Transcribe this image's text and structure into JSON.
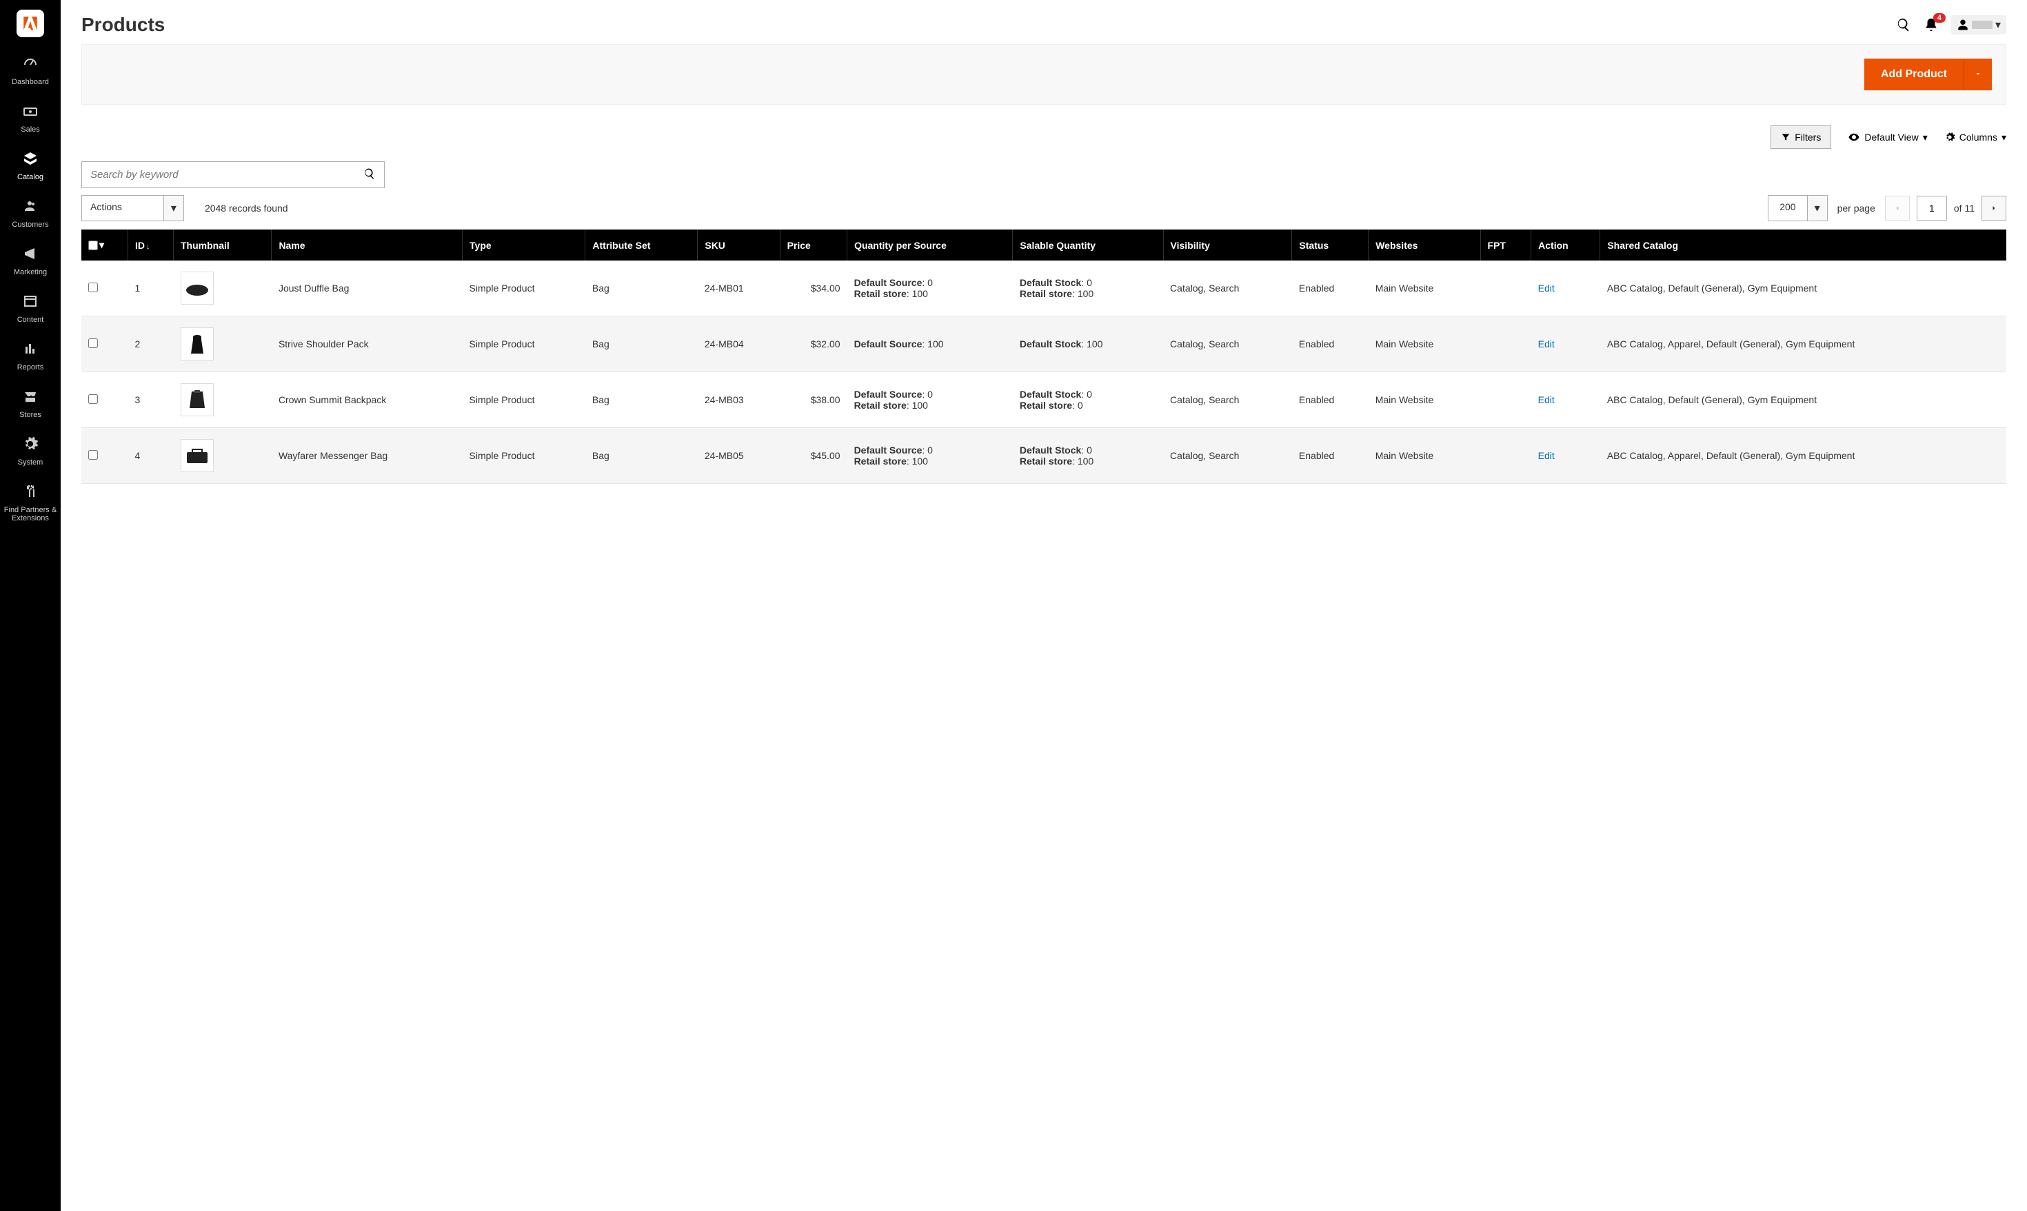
{
  "page": {
    "title": "Products",
    "notification_count": "4"
  },
  "sidebar": {
    "items": [
      {
        "label": "Dashboard"
      },
      {
        "label": "Sales"
      },
      {
        "label": "Catalog"
      },
      {
        "label": "Customers"
      },
      {
        "label": "Marketing"
      },
      {
        "label": "Content"
      },
      {
        "label": "Reports"
      },
      {
        "label": "Stores"
      },
      {
        "label": "System"
      },
      {
        "label": "Find Partners & Extensions"
      }
    ]
  },
  "action_bar": {
    "add_product": "Add Product"
  },
  "toolbar": {
    "filters": "Filters",
    "default_view": "Default View",
    "columns": "Columns"
  },
  "search": {
    "placeholder": "Search by keyword"
  },
  "controls": {
    "actions_label": "Actions",
    "records_found": "2048 records found",
    "per_page_value": "200",
    "per_page_label": "per page",
    "current_page": "1",
    "of_pages": "of 11"
  },
  "columns": {
    "id": "ID",
    "thumbnail": "Thumbnail",
    "name": "Name",
    "type": "Type",
    "attribute_set": "Attribute Set",
    "sku": "SKU",
    "price": "Price",
    "qty_per_source": "Quantity per Source",
    "salable_qty": "Salable Quantity",
    "visibility": "Visibility",
    "status": "Status",
    "websites": "Websites",
    "fpt": "FPT",
    "action": "Action",
    "shared_catalog": "Shared Catalog"
  },
  "rows": [
    {
      "id": "1",
      "name": "Joust Duffle Bag",
      "type": "Simple Product",
      "attr_set": "Bag",
      "sku": "24-MB01",
      "price": "$34.00",
      "qty_source": [
        {
          "label": "Default Source",
          "val": "0"
        },
        {
          "label": "Retail store",
          "val": "100"
        }
      ],
      "salable": [
        {
          "label": "Default Stock",
          "val": "0"
        },
        {
          "label": "Retail store",
          "val": "100"
        }
      ],
      "visibility": "Catalog, Search",
      "status": "Enabled",
      "websites": "Main Website",
      "action": "Edit",
      "shared": "ABC Catalog, Default (General), Gym Equipment"
    },
    {
      "id": "2",
      "name": "Strive Shoulder Pack",
      "type": "Simple Product",
      "attr_set": "Bag",
      "sku": "24-MB04",
      "price": "$32.00",
      "qty_source": [
        {
          "label": "Default Source",
          "val": "100"
        }
      ],
      "salable": [
        {
          "label": "Default Stock",
          "val": "100"
        }
      ],
      "visibility": "Catalog, Search",
      "status": "Enabled",
      "websites": "Main Website",
      "action": "Edit",
      "shared": "ABC Catalog, Apparel, Default (General), Gym Equipment"
    },
    {
      "id": "3",
      "name": "Crown Summit Backpack",
      "type": "Simple Product",
      "attr_set": "Bag",
      "sku": "24-MB03",
      "price": "$38.00",
      "qty_source": [
        {
          "label": "Default Source",
          "val": "0"
        },
        {
          "label": "Retail store",
          "val": "100"
        }
      ],
      "salable": [
        {
          "label": "Default Stock",
          "val": "0"
        },
        {
          "label": "Retail store",
          "val": "0"
        }
      ],
      "visibility": "Catalog, Search",
      "status": "Enabled",
      "websites": "Main Website",
      "action": "Edit",
      "shared": "ABC Catalog, Default (General), Gym Equipment"
    },
    {
      "id": "4",
      "name": "Wayfarer Messenger Bag",
      "type": "Simple Product",
      "attr_set": "Bag",
      "sku": "24-MB05",
      "price": "$45.00",
      "qty_source": [
        {
          "label": "Default Source",
          "val": "0"
        },
        {
          "label": "Retail store",
          "val": "100"
        }
      ],
      "salable": [
        {
          "label": "Default Stock",
          "val": "0"
        },
        {
          "label": "Retail store",
          "val": "100"
        }
      ],
      "visibility": "Catalog, Search",
      "status": "Enabled",
      "websites": "Main Website",
      "action": "Edit",
      "shared": "ABC Catalog, Apparel, Default (General), Gym Equipment"
    }
  ]
}
